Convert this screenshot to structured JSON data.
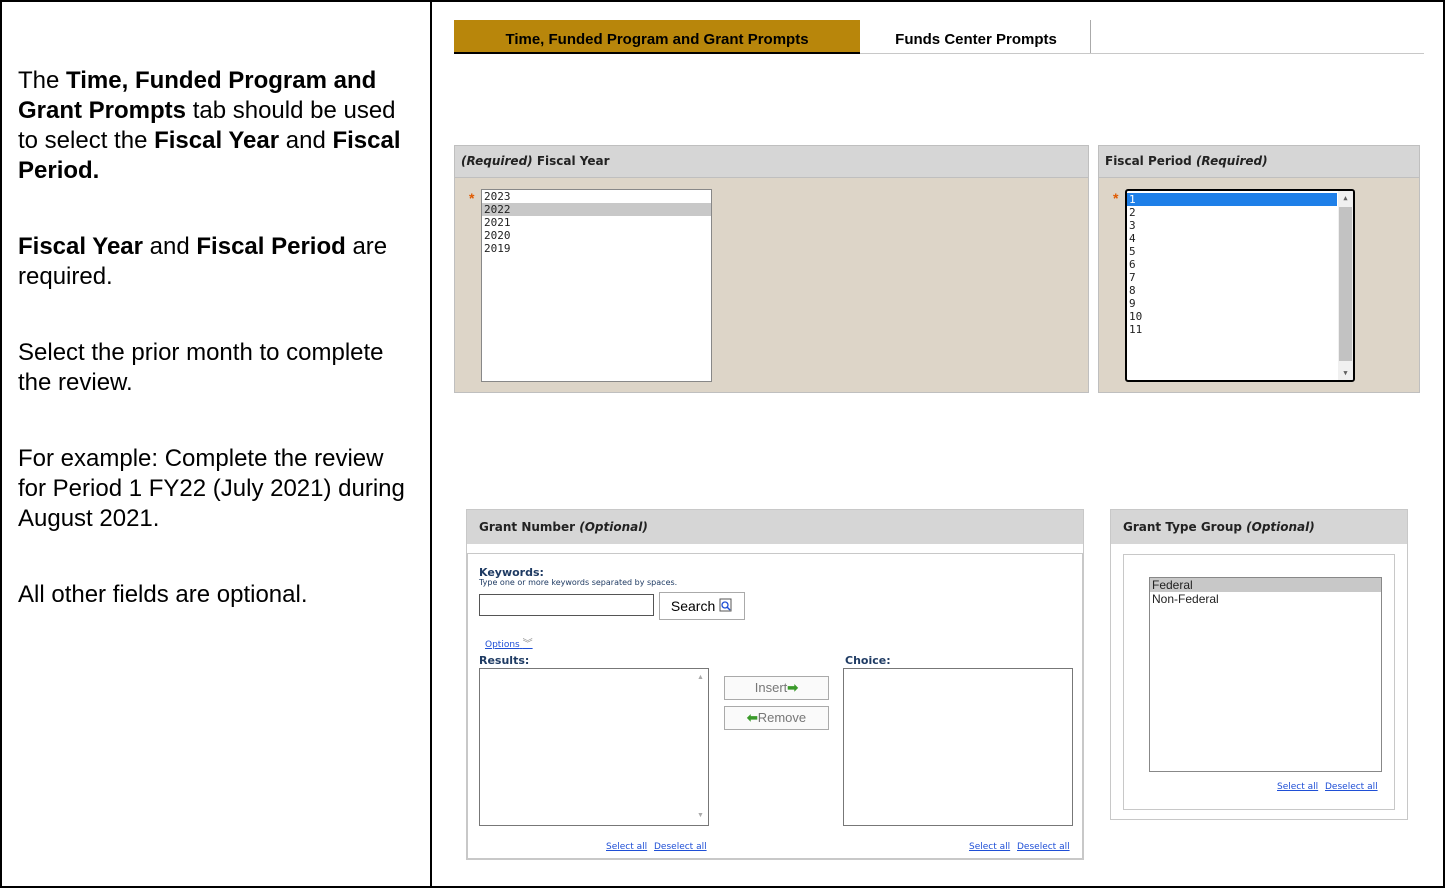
{
  "instructions": {
    "p1_a": "The ",
    "p1_b": "Time, Funded Program and Grant Prompts",
    "p1_c": " tab should be used to select the ",
    "p1_d": "Fiscal Year",
    "p1_e": " and ",
    "p1_f": "Fiscal Period.",
    "p2_a": "Fiscal Year",
    "p2_b": " and ",
    "p2_c": "Fiscal Period",
    "p2_d": " are required.",
    "p3": "Select the prior month to complete the review.",
    "p4": "For example: Complete the review for Period 1 FY22 (July 2021) during August 2021.",
    "p5": "All other fields are optional."
  },
  "tabs": {
    "active": "Time, Funded Program and Grant  Prompts",
    "inactive": "Funds Center Prompts"
  },
  "fiscal_year": {
    "header_req": "(Required)",
    "header_title": " Fiscal Year",
    "required_mark": "*",
    "options": [
      "2023",
      "2022",
      "2021",
      "2020",
      "2019"
    ],
    "selected": "2022"
  },
  "fiscal_period": {
    "header_title": "Fiscal Period ",
    "header_req": "(Required)",
    "required_mark": "*",
    "options": [
      "1",
      "2",
      "3",
      "4",
      "5",
      "6",
      "7",
      "8",
      "9",
      "10",
      "11"
    ],
    "selected": "1"
  },
  "grant_number": {
    "header_title": "Grant Number ",
    "header_opt": "(Optional)",
    "keywords_label": "Keywords:",
    "keywords_hint": "Type one or more keywords separated by spaces.",
    "search_label": "Search",
    "options_label": "Options",
    "results_label": "Results:",
    "choice_label": "Choice:",
    "insert_label": "Insert",
    "remove_label": "Remove",
    "select_all": "Select all",
    "deselect_all": "Deselect all"
  },
  "grant_type_group": {
    "header_title": "Grant Type Group ",
    "header_opt": "(Optional)",
    "options": [
      "Federal",
      "Non-Federal"
    ],
    "selected": "Federal",
    "select_all": "Select all",
    "deselect_all": "Deselect all"
  }
}
